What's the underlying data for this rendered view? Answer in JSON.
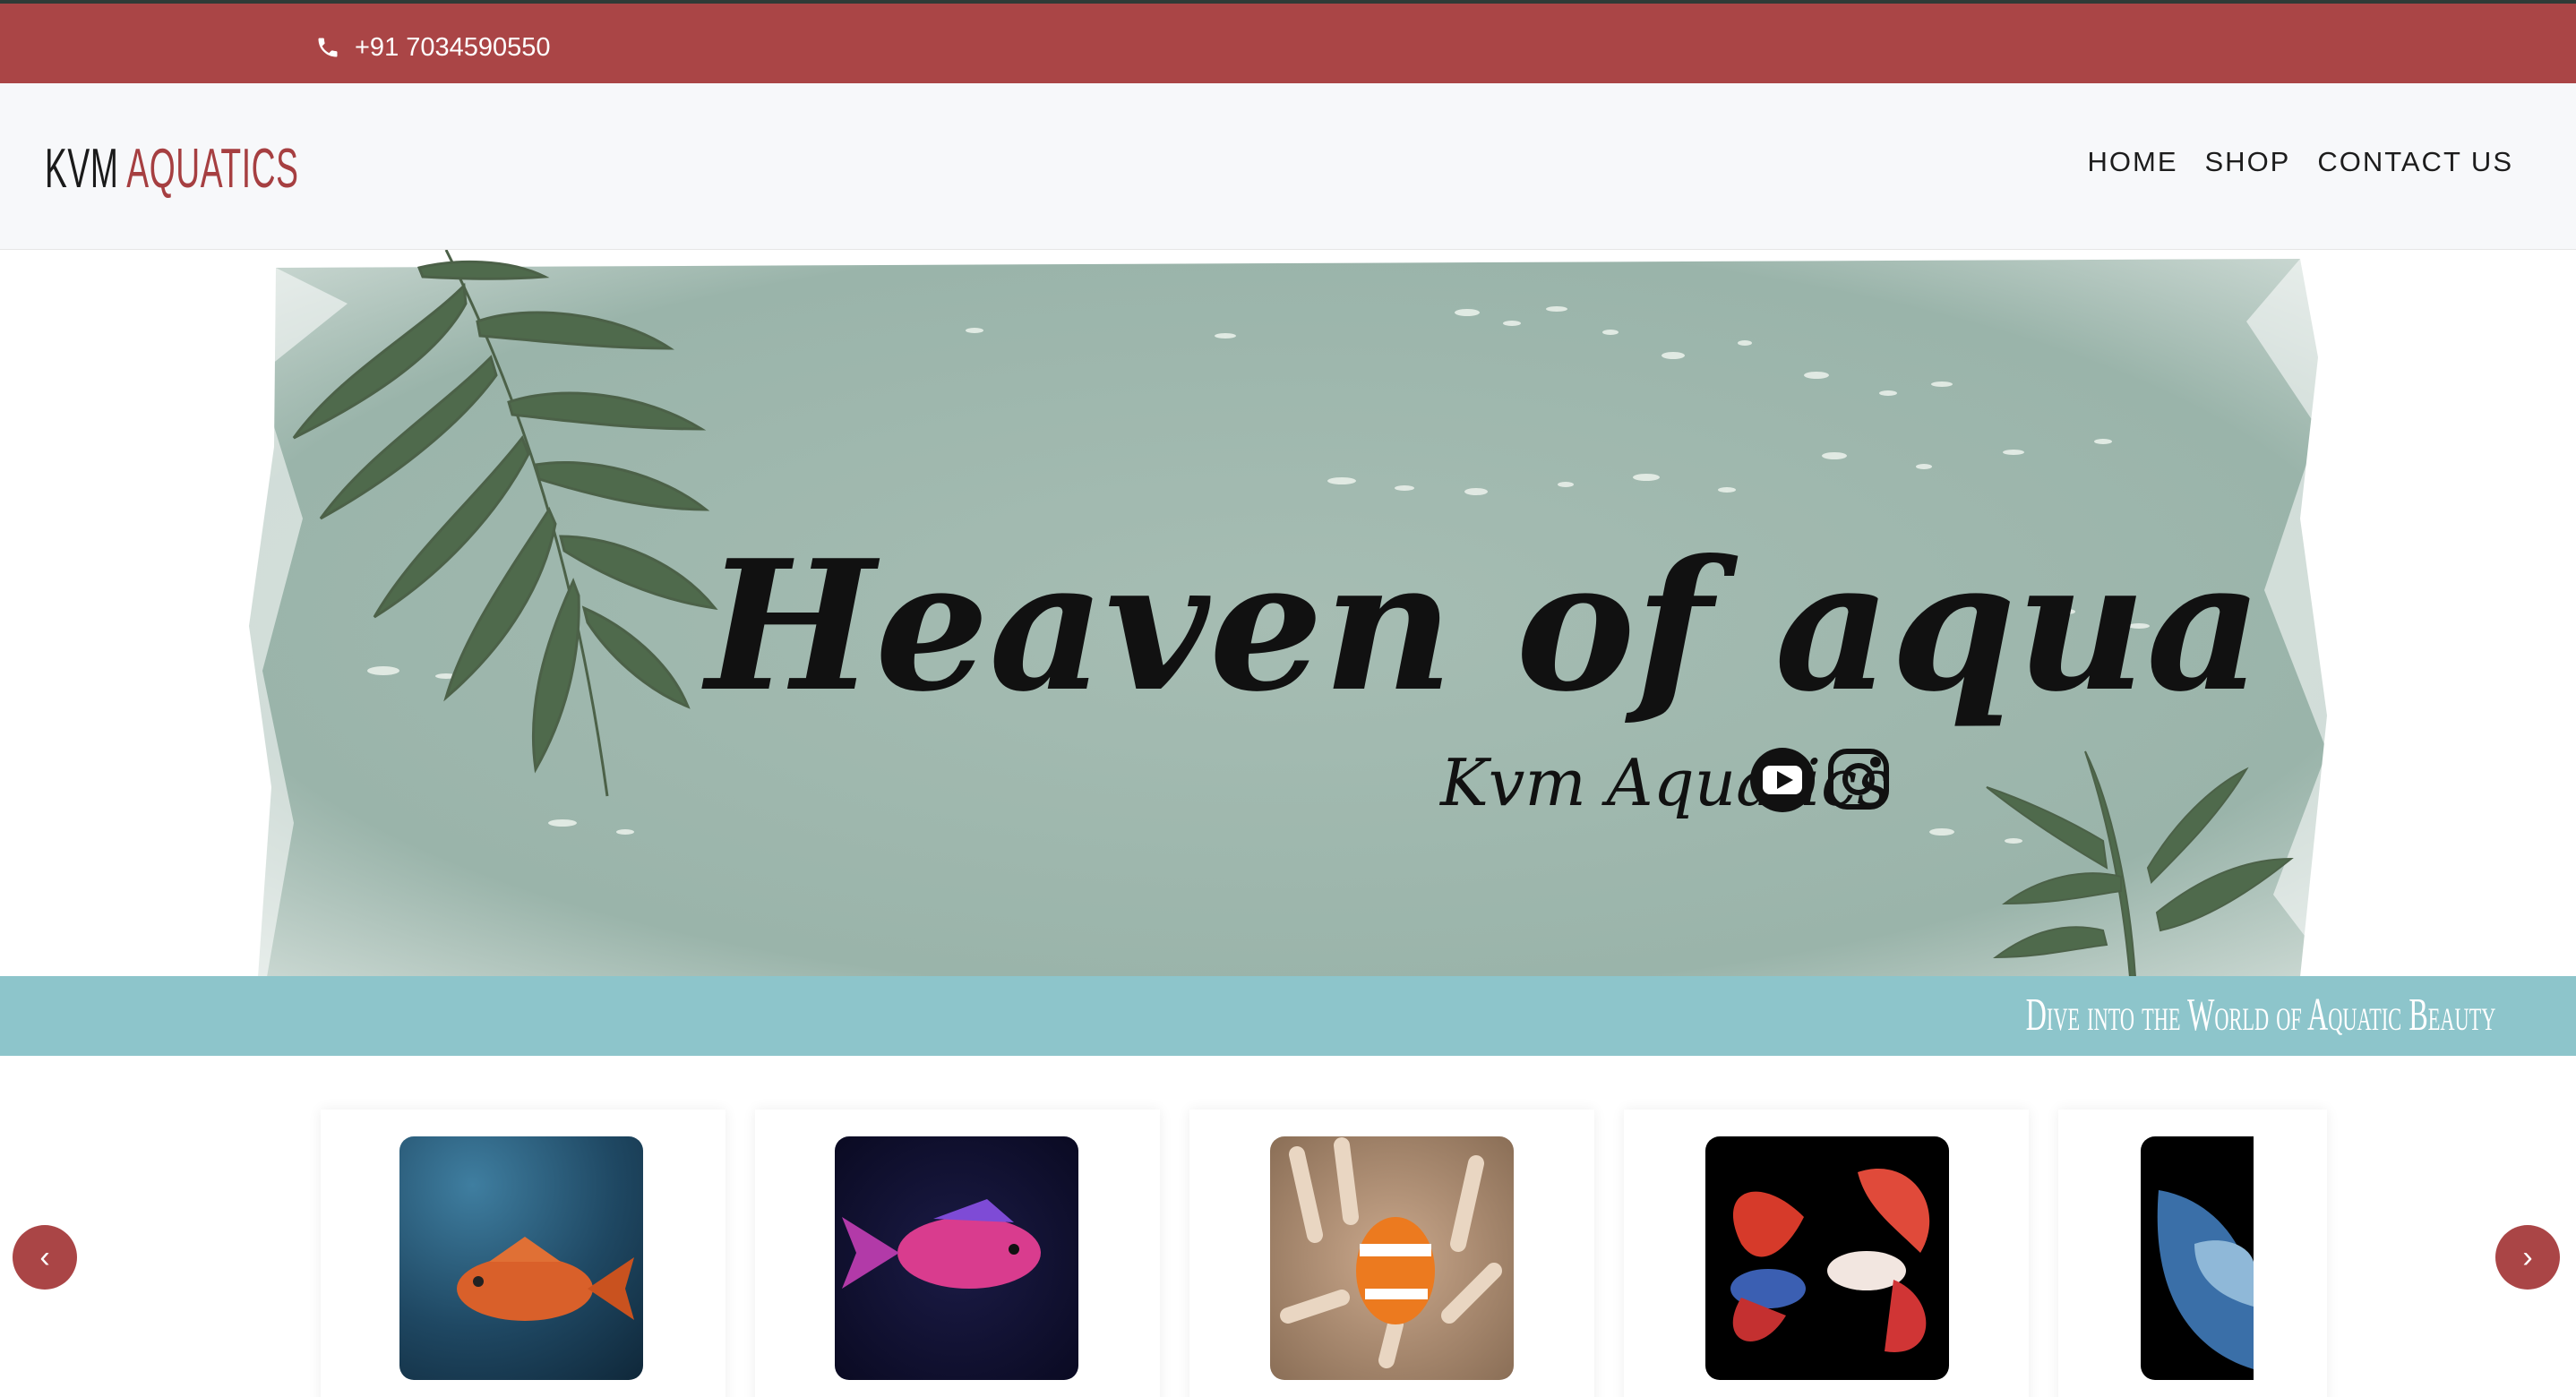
{
  "topbar": {
    "phone": "+91 7034590550",
    "phone_icon": "phone-icon"
  },
  "header": {
    "logo_part1": "KVM",
    "logo_part2": "AQUATICS",
    "nav": [
      "HOME",
      "SHOP",
      "CONTACT US"
    ]
  },
  "hero": {
    "headline": "Heaven of aqua",
    "subline": "Kvm Aquatics",
    "icons": [
      "youtube-icon",
      "instagram-icon"
    ]
  },
  "strip": {
    "tagline": "Dive into the World of Aquatic Beauty"
  },
  "carousel": {
    "prev_label": "‹",
    "next_label": "›",
    "items": [
      "orange-rockfish",
      "purple-anthias",
      "clownfish-anemone",
      "betta-pair",
      "blue-betta"
    ]
  },
  "colors": {
    "accent": "#aa4546",
    "strip": "#8dc5cb",
    "hero_bg": "#9fb8ae"
  }
}
